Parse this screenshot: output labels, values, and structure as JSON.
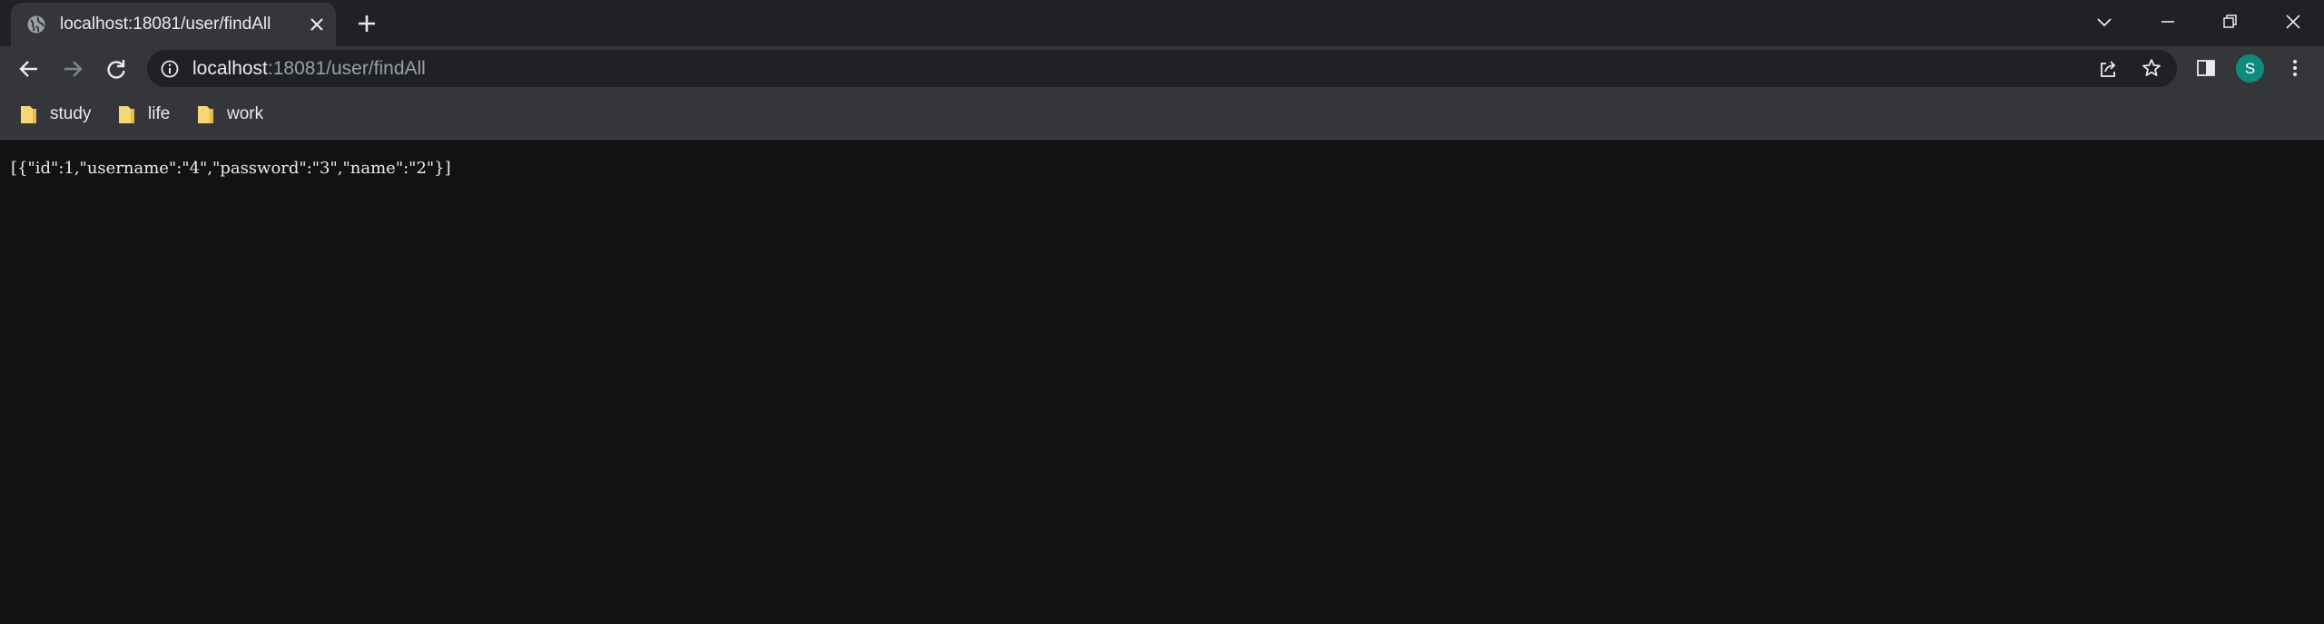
{
  "tab": {
    "title": "localhost:18081/user/findAll",
    "favicon": "globe-icon"
  },
  "address_bar": {
    "host": "localhost",
    "path": ":18081/user/findAll"
  },
  "profile": {
    "initial": "S",
    "color": "#0f8a7d"
  },
  "bookmarks": [
    {
      "label": "study",
      "icon": "folder-icon"
    },
    {
      "label": "life",
      "icon": "folder-icon"
    },
    {
      "label": "work",
      "icon": "folder-icon"
    }
  ],
  "page": {
    "body_text": "[{\"id\":1,\"username\":\"4\",\"password\":\"3\",\"name\":\"2\"}]"
  },
  "colors": {
    "tabstrip": "#202124",
    "toolbar": "#35363a",
    "page_bg": "#121212",
    "folder": "#f7d674"
  }
}
